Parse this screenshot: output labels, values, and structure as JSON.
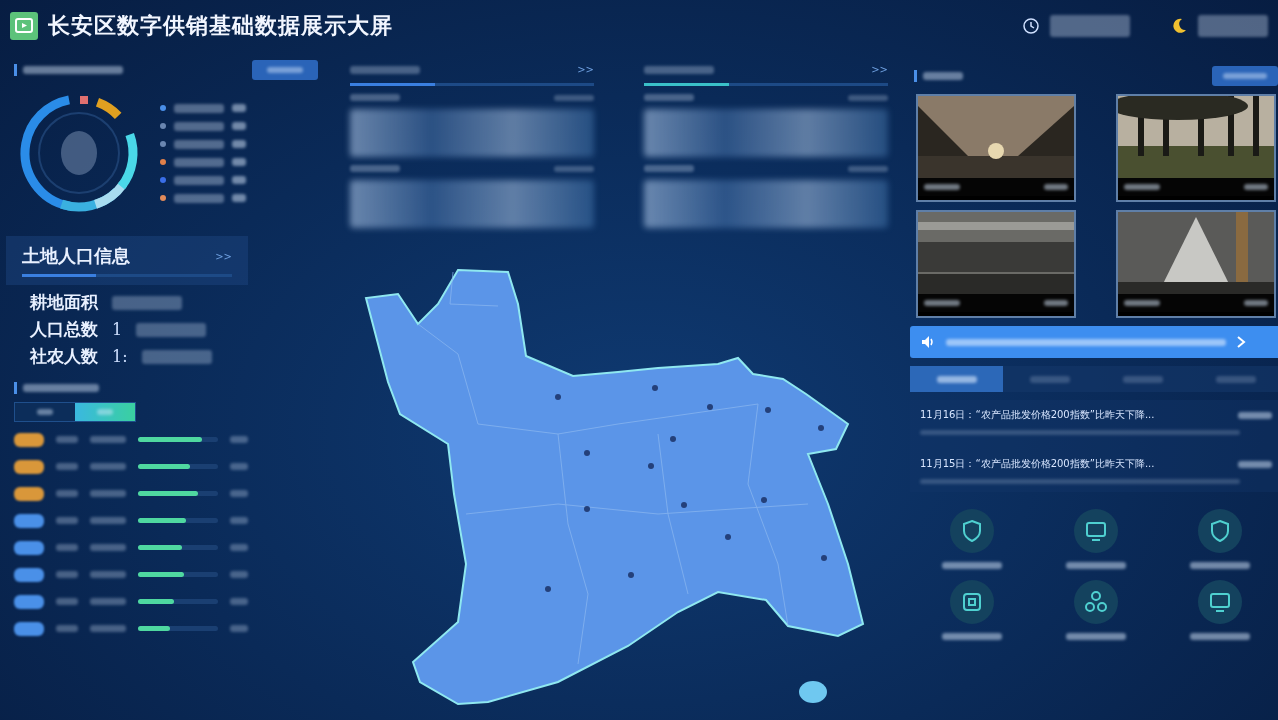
{
  "header": {
    "title": "长安区数字供销基础数据展示大屏"
  },
  "agri_panel": {
    "legend": [
      {
        "color": "#4a8fe8"
      },
      {
        "color": "#6a86b0"
      },
      {
        "color": "#6a86b0"
      },
      {
        "color": "#e0804a"
      },
      {
        "color": "#3a6ee8"
      },
      {
        "color": "#e08a5a"
      }
    ]
  },
  "land_panel": {
    "title": "土地人口信息",
    "more": ">>",
    "rows": [
      {
        "label": "耕地面积",
        "value": ""
      },
      {
        "label": "人口总数",
        "value": "1"
      },
      {
        "label": "社农人数",
        "value": "1:"
      }
    ]
  },
  "distribution_panel": {
    "toggle": [
      {
        "selected": false
      },
      {
        "selected": true
      }
    ],
    "rows": [
      {
        "color": "#d9973a",
        "level": 0.8
      },
      {
        "color": "#d9973a",
        "level": 0.65
      },
      {
        "color": "#d9973a",
        "level": 0.75
      },
      {
        "color": "#4a90e8",
        "level": 0.6
      },
      {
        "color": "#4a90e8",
        "level": 0.55
      },
      {
        "color": "#4a90e8",
        "level": 0.58
      },
      {
        "color": "#4a90e8",
        "level": 0.45
      },
      {
        "color": "#4a90e8",
        "level": 0.4
      }
    ]
  },
  "middle_panels": [
    {
      "more": ">>"
    },
    {
      "more": ">>"
    }
  ],
  "news_tabs": [
    {
      "selected": true
    },
    {
      "selected": false
    },
    {
      "selected": false
    },
    {
      "selected": false
    }
  ],
  "news": [
    {
      "title": "11月16日：“农产品批发价格200指数”比昨天下降..."
    },
    {
      "title": "11月15日：“农产品批发价格200指数”比昨天下降..."
    }
  ],
  "systems": [
    {
      "kind": "shield"
    },
    {
      "kind": "monitor"
    },
    {
      "kind": "shield"
    },
    {
      "kind": "square"
    },
    {
      "kind": "nodes"
    },
    {
      "kind": "monitor"
    }
  ]
}
